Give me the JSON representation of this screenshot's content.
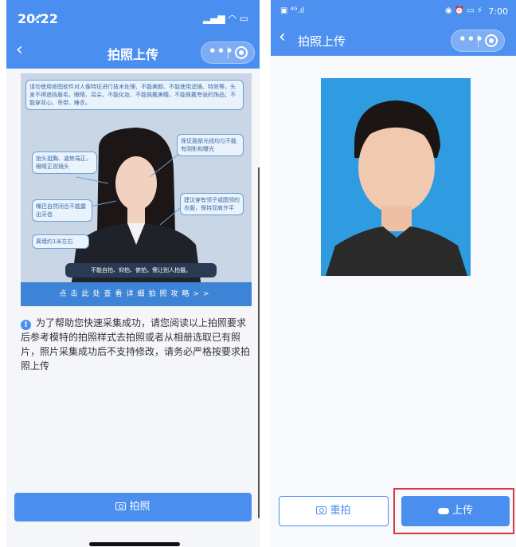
{
  "left": {
    "status": {
      "time": "20:22",
      "signal_icons": "▂▄▆ ◠ ▭"
    },
    "nav": {
      "title": "拍照上传",
      "menu_icon": "more-dots",
      "close_icon": "target-circle"
    },
    "guide": {
      "bubbles": [
        "请勿使用修图软件对人像特征进行技术处理、不能美颜、不能使用滤镜、特效等，头发不得遮挡眉毛、眼睛、耳朵，不能化妆、不能佩戴美瞳，不能佩戴夸张的饰品；不能穿背心、吊带、睡衣。",
        "保证面部光线均匀不能有阴影和曝光",
        "抬头挺胸、姿势端正，眼睛正视镜头",
        "嘴巴自然闭合不能露出牙齿",
        "建议穿有领子或圆领的衣服，保持双肩齐平",
        "离墙约1米左右",
        "不能自拍、仰拍、俯拍，需让别人拍摄。"
      ],
      "strip_text": "点击此处查看详细拍照攻略>>"
    },
    "hint_text": "为了帮助您快速采集成功，请您阅读以上拍照要求后参考模特的拍照样式去拍照或者从相册选取已有照片，照片采集成功后不支持修改，请务必严格按要求拍照上传",
    "button_label": "拍照"
  },
  "right": {
    "status": {
      "left_icons": "▣ ⁴ᴳ.ıl",
      "right_icons": "◉ ⏰ ▭ ⚡",
      "time": "7:00"
    },
    "nav": {
      "title": "拍照上传",
      "back_icon": "chevron-left"
    },
    "retake_label": "重拍",
    "upload_label": "上传"
  },
  "colors": {
    "brand_blue": "#4a8ef0",
    "highlight_red": "#d83a3a",
    "photo_bg": "#2f9be0"
  }
}
